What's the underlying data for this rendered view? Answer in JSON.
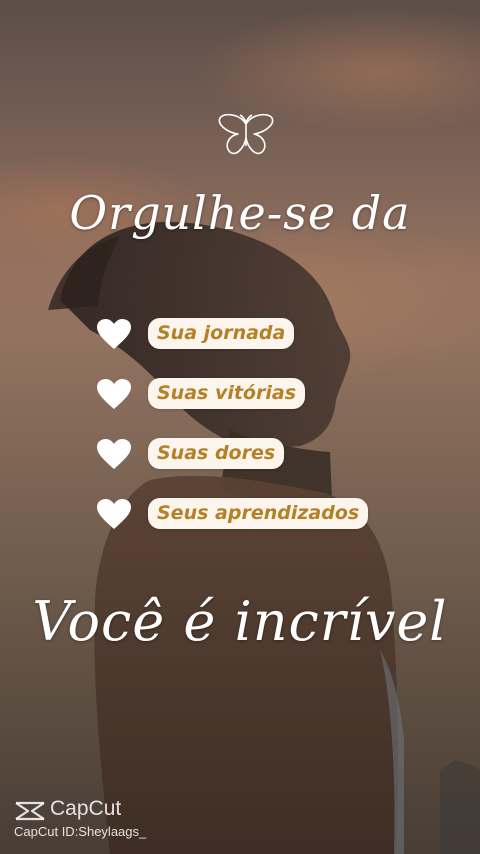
{
  "headline_top": "Orgulhe-se da",
  "items": [
    {
      "label": "Sua jornada"
    },
    {
      "label": "Suas vitórias"
    },
    {
      "label": "Suas dores"
    },
    {
      "label": "Seus aprendizados"
    }
  ],
  "headline_bottom": "Você é incrível",
  "watermark": {
    "name": "CapCut",
    "id_text": "CapCut ID:Sheylaags_"
  },
  "colors": {
    "pill_bg": "#fbf5ee",
    "pill_text": "#b58127",
    "headline": "#ffffff"
  },
  "icons": [
    "butterfly-icon",
    "heart-icon",
    "capcut-logo-icon"
  ]
}
